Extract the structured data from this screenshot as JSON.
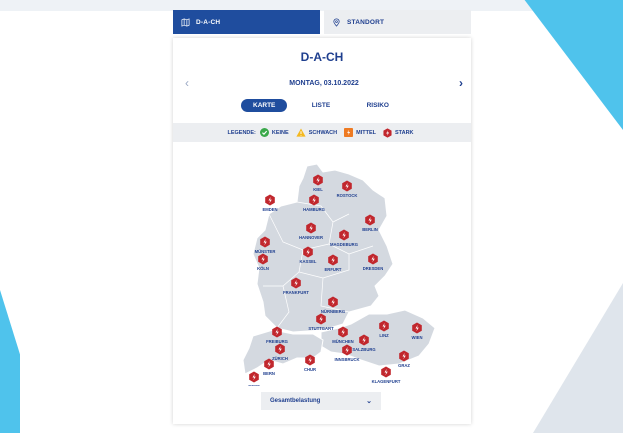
{
  "tabs": [
    {
      "label": "D-A-CH",
      "icon": "map-icon",
      "active": true
    },
    {
      "label": "STANDORT",
      "icon": "location-pin-icon",
      "active": false
    }
  ],
  "region_title": "D-A-CH",
  "date": "MONTAG, 03.10.2022",
  "view_options": [
    {
      "label": "KARTE",
      "active": true
    },
    {
      "label": "LISTE",
      "active": false
    },
    {
      "label": "RISIKO",
      "active": false
    }
  ],
  "legend": {
    "title": "LEGENDE:",
    "items": [
      {
        "label": "KEINE",
        "icon": "check-circle-icon",
        "color": "#3aa84a"
      },
      {
        "label": "SCHWACH",
        "icon": "warning-triangle-icon",
        "color": "#f4b81f"
      },
      {
        "label": "MITTEL",
        "icon": "medium-square-icon",
        "color": "#ee7a22"
      },
      {
        "label": "STARK",
        "icon": "strong-hexagon-icon",
        "color": "#c1272d"
      }
    ]
  },
  "colors": {
    "primary": "#1f4d9e",
    "text": "#1f3f8f",
    "strong": "#c1272d",
    "map_fill": "#d4d9e0",
    "map_border": "#ffffff",
    "accent": "#4fc3ec"
  },
  "cities": [
    {
      "name": "KIEL",
      "level": "stark"
    },
    {
      "name": "ROSTOCK",
      "level": "stark"
    },
    {
      "name": "HAMBURG",
      "level": "stark"
    },
    {
      "name": "EMDEN",
      "level": "stark"
    },
    {
      "name": "BERLIN",
      "level": "stark"
    },
    {
      "name": "HANNOVER",
      "level": "stark"
    },
    {
      "name": "MAGDEBURG",
      "level": "stark"
    },
    {
      "name": "MÜNSTER",
      "level": "stark"
    },
    {
      "name": "KASSEL",
      "level": "stark"
    },
    {
      "name": "KÖLN",
      "level": "stark"
    },
    {
      "name": "ERFURT",
      "level": "stark"
    },
    {
      "name": "DRESDEN",
      "level": "stark"
    },
    {
      "name": "FRANKFURT",
      "level": "stark"
    },
    {
      "name": "NÜRNBERG",
      "level": "stark"
    },
    {
      "name": "STUTTGART",
      "level": "stark"
    },
    {
      "name": "FREIBURG",
      "level": "stark"
    },
    {
      "name": "MÜNCHEN",
      "level": "stark"
    },
    {
      "name": "LINZ",
      "level": "stark"
    },
    {
      "name": "WIEN",
      "level": "stark"
    },
    {
      "name": "SALZBURG",
      "level": "stark"
    },
    {
      "name": "ZÜRICH",
      "level": "stark"
    },
    {
      "name": "INNSBRUCK",
      "level": "stark"
    },
    {
      "name": "GRAZ",
      "level": "stark"
    },
    {
      "name": "BERN",
      "level": "stark"
    },
    {
      "name": "CHUR",
      "level": "stark"
    },
    {
      "name": "KLAGENFURT",
      "level": "stark"
    },
    {
      "name": "GENF",
      "level": "stark"
    }
  ],
  "dropdown": {
    "selected": "Gesamtbelastung"
  }
}
